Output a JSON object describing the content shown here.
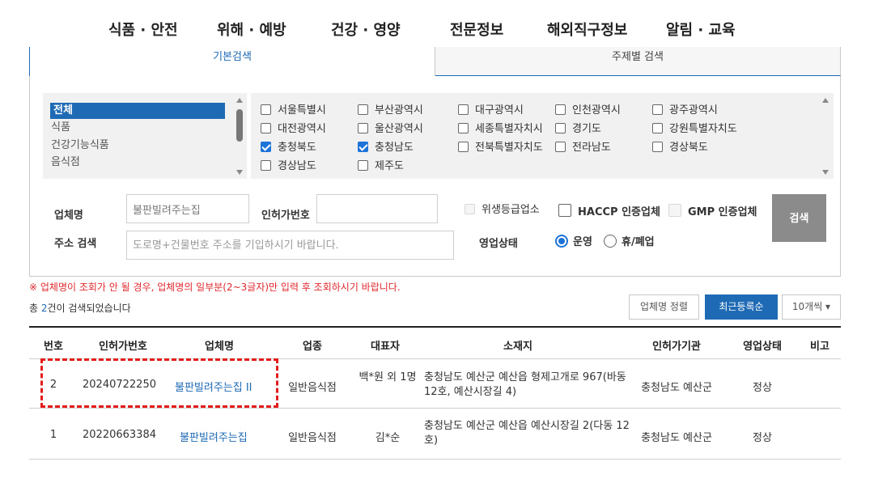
{
  "nav": [
    "식품 · 안전",
    "위해 · 예방",
    "건강 · 영양",
    "전문정보",
    "해외직구정보",
    "알림 · 교육"
  ],
  "tabs": {
    "basic": "기본검색",
    "topic": "주제별 검색"
  },
  "categories": [
    "전체",
    "식품",
    "건강기능식품",
    "음식점"
  ],
  "regions": [
    {
      "label": "서울특별시",
      "checked": false
    },
    {
      "label": "부산광역시",
      "checked": false
    },
    {
      "label": "대구광역시",
      "checked": false
    },
    {
      "label": "인천광역시",
      "checked": false
    },
    {
      "label": "광주광역시",
      "checked": false
    },
    {
      "label": "대전광역시",
      "checked": false
    },
    {
      "label": "울산광역시",
      "checked": false
    },
    {
      "label": "세종특별자치시",
      "checked": false
    },
    {
      "label": "경기도",
      "checked": false
    },
    {
      "label": "강원특별자치도",
      "checked": false
    },
    {
      "label": "충청북도",
      "checked": true
    },
    {
      "label": "충청남도",
      "checked": true
    },
    {
      "label": "전북특별자치도",
      "checked": false
    },
    {
      "label": "전라남도",
      "checked": false
    },
    {
      "label": "경상북도",
      "checked": false
    },
    {
      "label": "경상남도",
      "checked": false
    },
    {
      "label": "제주도",
      "checked": false
    }
  ],
  "form": {
    "business_name_label": "업체명",
    "business_name_value": "불판빌려주는집",
    "license_label": "인허가번호",
    "license_value": "",
    "address_label": "주소 검색",
    "address_placeholder": "도로명+건물번호 주소를 기입하시기 바랍니다.",
    "hygiene_label": "위생등급업소",
    "haccp_label": "HACCP 인증업체",
    "gmp_label": "GMP 인증업체",
    "status_label": "영업상태",
    "status_active": "운영",
    "status_closed": "휴/폐업",
    "search_button": "검색"
  },
  "notice": "※ 업체명이 조회가 안 될 경우, 업체명의 일부분(2~3글자)만 입력 후 조회하시기 바랍니다.",
  "results": {
    "prefix": "총 ",
    "count": "2",
    "suffix": "건이 검색되었습니다"
  },
  "sort": {
    "by_name": "업체명 정렬",
    "recent": "최근등록순",
    "per_page": "10개씩 ▾"
  },
  "table": {
    "headers": [
      "번호",
      "인허가번호",
      "업체명",
      "업종",
      "대표자",
      "소재지",
      "인허가기관",
      "영업상태",
      "비고"
    ],
    "rows": [
      {
        "no": "2",
        "license": "20240722250",
        "name": "불판빌려주는집 II",
        "type": "일반음식점",
        "owner": "백*원 외 1명",
        "address": "충청남도 예산군 예산읍 형제고개로 967(바동 12호, 예산시장길 4)",
        "agency": "충청남도 예산군",
        "status": "정상",
        "note": ""
      },
      {
        "no": "1",
        "license": "20220663384",
        "name": "불판빌려주는집",
        "type": "일반음식점",
        "owner": "김*순",
        "address": "충청남도 예산군 예산읍 예산시장길 2(다동 12호)",
        "agency": "충청남도 예산군",
        "status": "정상",
        "note": ""
      }
    ]
  }
}
